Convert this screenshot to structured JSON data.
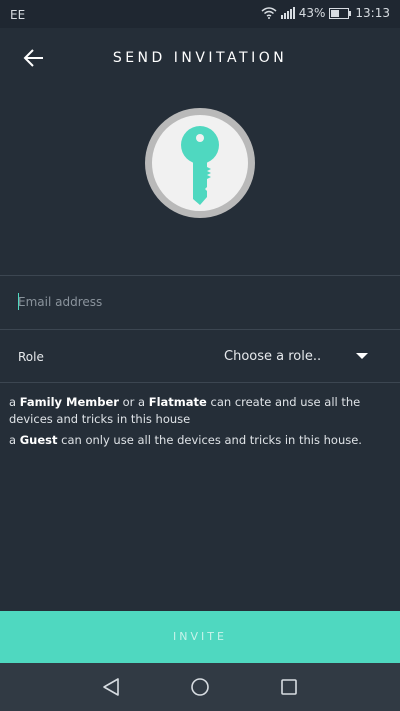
{
  "status_bar": {
    "carrier": "EE",
    "battery": "43%",
    "time": "13:13"
  },
  "header": {
    "title": "SEND INVITATION",
    "back_icon": "arrow-left-icon"
  },
  "illustration": {
    "icon": "key-icon",
    "accent_color": "#4fd8c0"
  },
  "form": {
    "email": {
      "placeholder": "Email address",
      "value": ""
    },
    "role": {
      "label": "Role",
      "selected": "Choose a role..",
      "icon": "dropdown-arrow-icon"
    }
  },
  "help": {
    "line1": {
      "prefix": "a ",
      "role_a": "Family Member",
      "middle": " or a ",
      "role_b": "Flatmate",
      "suffix": " can create and use all the devices and tricks in this house"
    },
    "line2": {
      "prefix": "a ",
      "role": "Guest",
      "suffix": " can only use all the devices and tricks in this house."
    }
  },
  "actions": {
    "invite_label": "INVITE"
  },
  "nav": {
    "back_icon": "triangle-back-icon",
    "home_icon": "circle-home-icon",
    "recents_icon": "square-recents-icon"
  },
  "colors": {
    "background": "#252e38",
    "accent": "#4fd8c0",
    "nav_bar": "#313a44"
  }
}
